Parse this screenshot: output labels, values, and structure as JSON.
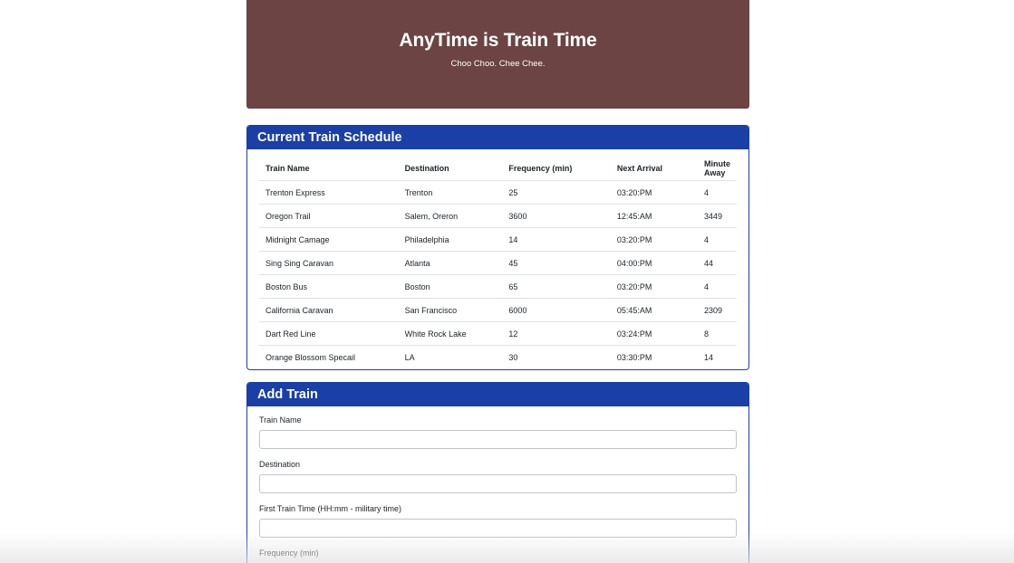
{
  "header": {
    "title": "AnyTime is Train Time",
    "subtitle": "Choo Choo. Chee Chee."
  },
  "schedule": {
    "title": "Current Train Schedule",
    "columns": [
      "Train Name",
      "Destination",
      "Frequency (min)",
      "Next Arrival",
      "Minute Away"
    ],
    "rows": [
      [
        "Trenton Express",
        "Trenton",
        "25",
        "03:20:PM",
        "4"
      ],
      [
        "Oregon Trail",
        "Salem, Oreron",
        "3600",
        "12:45:AM",
        "3449"
      ],
      [
        "Midnight Camage",
        "Philadelphia",
        "14",
        "03:20:PM",
        "4"
      ],
      [
        "Sing Sing Caravan",
        "Atlanta",
        "45",
        "04:00:PM",
        "44"
      ],
      [
        "Boston Bus",
        "Boston",
        "65",
        "03:20:PM",
        "4"
      ],
      [
        "California Caravan",
        "San Francisco",
        "6000",
        "05:45:AM",
        "2309"
      ],
      [
        "Dart Red Line",
        "White Rock Lake",
        "12",
        "03:24:PM",
        "8"
      ],
      [
        "Orange Blossom Specail",
        "LA",
        "30",
        "03:30:PM",
        "14"
      ]
    ]
  },
  "add_train": {
    "title": "Add Train",
    "fields": [
      {
        "label": "Train Name",
        "value": ""
      },
      {
        "label": "Destination",
        "value": ""
      },
      {
        "label": "First Train Time (HH:mm - military time)",
        "value": ""
      },
      {
        "label": "Frequency (min)",
        "value": ""
      }
    ]
  },
  "colors": {
    "jumbotron_bg": "#6b4443",
    "card_accent": "#1a3fa6"
  }
}
